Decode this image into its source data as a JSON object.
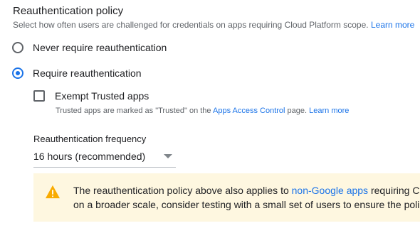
{
  "policy": {
    "title": "Reauthentication policy",
    "description": "Select how often users are challenged for credentials on apps requiring Cloud Platform scope.",
    "learn_more": "Learn more"
  },
  "options": {
    "never": {
      "label": "Never require reauthentication",
      "selected": false
    },
    "require": {
      "label": "Require reauthentication",
      "selected": true
    }
  },
  "exempt": {
    "label": "Exempt Trusted apps",
    "checked": false,
    "help_prefix": "Trusted apps are marked as \"Trusted\" on the ",
    "help_link": "Apps Access Control",
    "help_suffix": " page.",
    "learn_more": "Learn more"
  },
  "frequency": {
    "label": "Reauthentication frequency",
    "value": "16 hours (recommended)"
  },
  "notice": {
    "line1_prefix": "The reauthentication policy above also applies to ",
    "line1_link": "non-Google apps",
    "line1_suffix": " requiring Cl",
    "line2": "on a broader scale, consider testing with a small set of users to ensure the poli"
  },
  "colors": {
    "accent": "#1a73e8",
    "notice_bg": "#fef7e0",
    "warning": "#f9ab00"
  }
}
